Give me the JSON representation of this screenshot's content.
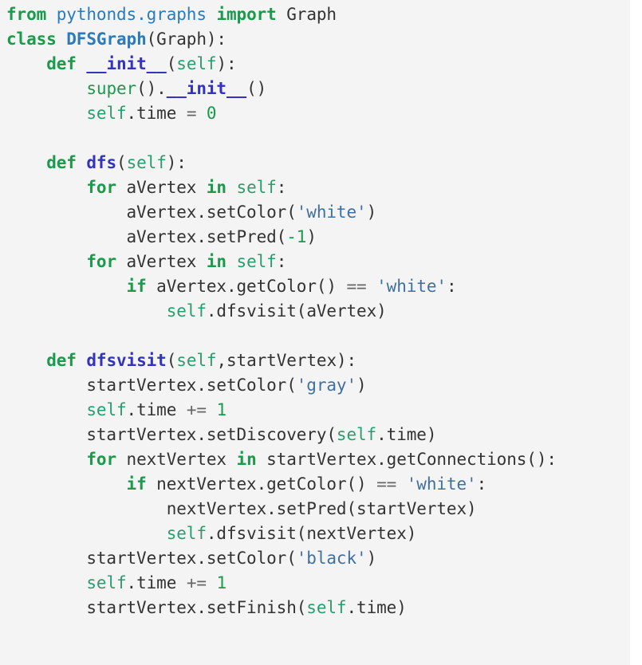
{
  "code_block": {
    "language": "python",
    "background_color": "#f4f4f4",
    "page_background_color": "#ffffff",
    "colors": {
      "keyword": "#1a9a4b",
      "module": "#2b7bba",
      "class_name": "#2b7bba",
      "function_name": "#3333bb",
      "dunder": "#3333bb",
      "self": "#2a9d6e",
      "string": "#4070a0",
      "number": "#1a9a4b",
      "builtin": "#1a9a4b",
      "operator": "#666666",
      "plain": "#333333"
    },
    "lines": [
      {
        "n": 1,
        "text": "from pythonds.graphs import Graph",
        "tokens": [
          {
            "t": "from",
            "c": "t-kw"
          },
          {
            "t": " ",
            "c": "t-pl"
          },
          {
            "t": "pythonds.graphs",
            "c": "t-mod"
          },
          {
            "t": " ",
            "c": "t-pl"
          },
          {
            "t": "import",
            "c": "t-kw"
          },
          {
            "t": " ",
            "c": "t-pl"
          },
          {
            "t": "Graph",
            "c": "t-pl"
          }
        ]
      },
      {
        "n": 2,
        "text": "class DFSGraph(Graph):",
        "tokens": [
          {
            "t": "class",
            "c": "t-kw"
          },
          {
            "t": " ",
            "c": "t-pl"
          },
          {
            "t": "DFSGraph",
            "c": "t-cls"
          },
          {
            "t": "(",
            "c": "t-pl"
          },
          {
            "t": "Graph",
            "c": "t-pl"
          },
          {
            "t": "):",
            "c": "t-pl"
          }
        ]
      },
      {
        "n": 3,
        "text": "    def __init__(self):",
        "tokens": [
          {
            "t": "    ",
            "c": "t-pl"
          },
          {
            "t": "def",
            "c": "t-kw"
          },
          {
            "t": " ",
            "c": "t-pl"
          },
          {
            "t": "__init__",
            "c": "t-dun"
          },
          {
            "t": "(",
            "c": "t-pl"
          },
          {
            "t": "self",
            "c": "t-self"
          },
          {
            "t": "):",
            "c": "t-pl"
          }
        ]
      },
      {
        "n": 4,
        "text": "        super().__init__()",
        "tokens": [
          {
            "t": "        ",
            "c": "t-pl"
          },
          {
            "t": "super",
            "c": "t-bi"
          },
          {
            "t": "().",
            "c": "t-pl"
          },
          {
            "t": "__init__",
            "c": "t-dun"
          },
          {
            "t": "()",
            "c": "t-pl"
          }
        ]
      },
      {
        "n": 5,
        "text": "        self.time = 0",
        "tokens": [
          {
            "t": "        ",
            "c": "t-pl"
          },
          {
            "t": "self",
            "c": "t-self"
          },
          {
            "t": ".time ",
            "c": "t-pl"
          },
          {
            "t": "=",
            "c": "t-op"
          },
          {
            "t": " ",
            "c": "t-pl"
          },
          {
            "t": "0",
            "c": "t-num"
          }
        ]
      },
      {
        "n": 6,
        "text": "",
        "tokens": []
      },
      {
        "n": 7,
        "text": "    def dfs(self):",
        "tokens": [
          {
            "t": "    ",
            "c": "t-pl"
          },
          {
            "t": "def",
            "c": "t-kw"
          },
          {
            "t": " ",
            "c": "t-pl"
          },
          {
            "t": "dfs",
            "c": "t-fn"
          },
          {
            "t": "(",
            "c": "t-pl"
          },
          {
            "t": "self",
            "c": "t-self"
          },
          {
            "t": "):",
            "c": "t-pl"
          }
        ]
      },
      {
        "n": 8,
        "text": "        for aVertex in self:",
        "tokens": [
          {
            "t": "        ",
            "c": "t-pl"
          },
          {
            "t": "for",
            "c": "t-kw"
          },
          {
            "t": " aVertex ",
            "c": "t-pl"
          },
          {
            "t": "in",
            "c": "t-kw"
          },
          {
            "t": " ",
            "c": "t-pl"
          },
          {
            "t": "self",
            "c": "t-self"
          },
          {
            "t": ":",
            "c": "t-pl"
          }
        ]
      },
      {
        "n": 9,
        "text": "            aVertex.setColor('white')",
        "tokens": [
          {
            "t": "            aVertex.setColor(",
            "c": "t-pl"
          },
          {
            "t": "'white'",
            "c": "t-str"
          },
          {
            "t": ")",
            "c": "t-pl"
          }
        ]
      },
      {
        "n": 10,
        "text": "            aVertex.setPred(-1)",
        "tokens": [
          {
            "t": "            aVertex.setPred(",
            "c": "t-pl"
          },
          {
            "t": "-1",
            "c": "t-num"
          },
          {
            "t": ")",
            "c": "t-pl"
          }
        ]
      },
      {
        "n": 11,
        "text": "        for aVertex in self:",
        "tokens": [
          {
            "t": "        ",
            "c": "t-pl"
          },
          {
            "t": "for",
            "c": "t-kw"
          },
          {
            "t": " aVertex ",
            "c": "t-pl"
          },
          {
            "t": "in",
            "c": "t-kw"
          },
          {
            "t": " ",
            "c": "t-pl"
          },
          {
            "t": "self",
            "c": "t-self"
          },
          {
            "t": ":",
            "c": "t-pl"
          }
        ]
      },
      {
        "n": 12,
        "text": "            if aVertex.getColor() == 'white':",
        "tokens": [
          {
            "t": "            ",
            "c": "t-pl"
          },
          {
            "t": "if",
            "c": "t-kw"
          },
          {
            "t": " aVertex.getColor() ",
            "c": "t-pl"
          },
          {
            "t": "==",
            "c": "t-op"
          },
          {
            "t": " ",
            "c": "t-pl"
          },
          {
            "t": "'white'",
            "c": "t-str"
          },
          {
            "t": ":",
            "c": "t-pl"
          }
        ]
      },
      {
        "n": 13,
        "text": "                self.dfsvisit(aVertex)",
        "tokens": [
          {
            "t": "                ",
            "c": "t-pl"
          },
          {
            "t": "self",
            "c": "t-self"
          },
          {
            "t": ".dfsvisit(aVertex)",
            "c": "t-pl"
          }
        ]
      },
      {
        "n": 14,
        "text": "",
        "tokens": []
      },
      {
        "n": 15,
        "text": "    def dfsvisit(self,startVertex):",
        "tokens": [
          {
            "t": "    ",
            "c": "t-pl"
          },
          {
            "t": "def",
            "c": "t-kw"
          },
          {
            "t": " ",
            "c": "t-pl"
          },
          {
            "t": "dfsvisit",
            "c": "t-fn"
          },
          {
            "t": "(",
            "c": "t-pl"
          },
          {
            "t": "self",
            "c": "t-self"
          },
          {
            "t": ",startVertex):",
            "c": "t-pl"
          }
        ]
      },
      {
        "n": 16,
        "text": "        startVertex.setColor('gray')",
        "tokens": [
          {
            "t": "        startVertex.setColor(",
            "c": "t-pl"
          },
          {
            "t": "'gray'",
            "c": "t-str"
          },
          {
            "t": ")",
            "c": "t-pl"
          }
        ]
      },
      {
        "n": 17,
        "text": "        self.time += 1",
        "tokens": [
          {
            "t": "        ",
            "c": "t-pl"
          },
          {
            "t": "self",
            "c": "t-self"
          },
          {
            "t": ".time ",
            "c": "t-pl"
          },
          {
            "t": "+=",
            "c": "t-op"
          },
          {
            "t": " ",
            "c": "t-pl"
          },
          {
            "t": "1",
            "c": "t-num"
          }
        ]
      },
      {
        "n": 18,
        "text": "        startVertex.setDiscovery(self.time)",
        "tokens": [
          {
            "t": "        startVertex.setDiscovery(",
            "c": "t-pl"
          },
          {
            "t": "self",
            "c": "t-self"
          },
          {
            "t": ".time)",
            "c": "t-pl"
          }
        ]
      },
      {
        "n": 19,
        "text": "        for nextVertex in startVertex.getConnections():",
        "tokens": [
          {
            "t": "        ",
            "c": "t-pl"
          },
          {
            "t": "for",
            "c": "t-kw"
          },
          {
            "t": " nextVertex ",
            "c": "t-pl"
          },
          {
            "t": "in",
            "c": "t-kw"
          },
          {
            "t": " startVertex.getConnections():",
            "c": "t-pl"
          }
        ]
      },
      {
        "n": 20,
        "text": "            if nextVertex.getColor() == 'white':",
        "tokens": [
          {
            "t": "            ",
            "c": "t-pl"
          },
          {
            "t": "if",
            "c": "t-kw"
          },
          {
            "t": " nextVertex.getColor() ",
            "c": "t-pl"
          },
          {
            "t": "==",
            "c": "t-op"
          },
          {
            "t": " ",
            "c": "t-pl"
          },
          {
            "t": "'white'",
            "c": "t-str"
          },
          {
            "t": ":",
            "c": "t-pl"
          }
        ]
      },
      {
        "n": 21,
        "text": "                nextVertex.setPred(startVertex)",
        "tokens": [
          {
            "t": "                nextVertex.setPred(startVertex)",
            "c": "t-pl"
          }
        ]
      },
      {
        "n": 22,
        "text": "                self.dfsvisit(nextVertex)",
        "tokens": [
          {
            "t": "                ",
            "c": "t-pl"
          },
          {
            "t": "self",
            "c": "t-self"
          },
          {
            "t": ".dfsvisit(nextVertex)",
            "c": "t-pl"
          }
        ]
      },
      {
        "n": 23,
        "text": "        startVertex.setColor('black')",
        "tokens": [
          {
            "t": "        startVertex.setColor(",
            "c": "t-pl"
          },
          {
            "t": "'black'",
            "c": "t-str"
          },
          {
            "t": ")",
            "c": "t-pl"
          }
        ]
      },
      {
        "n": 24,
        "text": "        self.time += 1",
        "tokens": [
          {
            "t": "        ",
            "c": "t-pl"
          },
          {
            "t": "self",
            "c": "t-self"
          },
          {
            "t": ".time ",
            "c": "t-pl"
          },
          {
            "t": "+=",
            "c": "t-op"
          },
          {
            "t": " ",
            "c": "t-pl"
          },
          {
            "t": "1",
            "c": "t-num"
          }
        ]
      },
      {
        "n": 25,
        "text": "        startVertex.setFinish(self.time)",
        "tokens": [
          {
            "t": "        startVertex.setFinish(",
            "c": "t-pl"
          },
          {
            "t": "self",
            "c": "t-self"
          },
          {
            "t": ".time)",
            "c": "t-pl"
          }
        ]
      }
    ]
  }
}
